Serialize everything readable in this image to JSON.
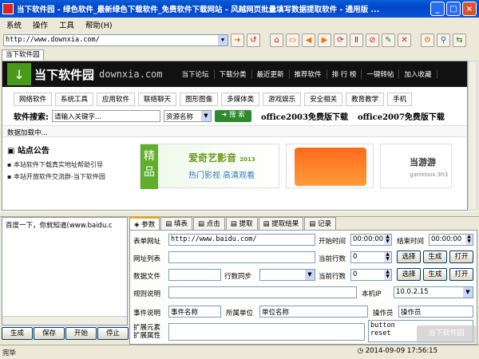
{
  "window": {
    "title": "当下软件园 - 绿色软件_最新绿色下载软件_免费软件下载网站 - 风越网页批量填写数据提取软件 - 通用版 ..."
  },
  "menu": [
    "系统",
    "操作",
    "工具",
    "帮助(H)"
  ],
  "toolbar": {
    "address": "http://www.downxia.com/"
  },
  "browser_tab": "当下软件园",
  "site": {
    "logo_icon": "↓",
    "logo_text": "当下软件园",
    "domain": "downxia.com",
    "topnav": [
      "当下论坛",
      "下载分类",
      "最近更新",
      "推荐软件",
      "排 行 榜",
      "一键转帖",
      "加入收藏"
    ],
    "categories": [
      "网络软件",
      "系统工具",
      "应用软件",
      "联络聊天",
      "图形图像",
      "多媒体类",
      "游戏娱乐",
      "安全相关",
      "教育教学",
      "手机"
    ],
    "search_label": "软件搜索:",
    "search_placeholder": "请输入关键字...",
    "search_scope": "资源名称",
    "search_button": "搜 索",
    "promo1": "office2003免费版下载",
    "promo2": "office2007免费版下载",
    "loading": "数据加载中...",
    "notice_title": "站点公告",
    "notices": [
      "本站软件下载真实地址帮助引导",
      "本站开放软件交流群-当下软件园"
    ],
    "banner_tag": "精",
    "banner_sub_tag": "品",
    "banner_title": "爱奇艺影音",
    "banner_year": "2013",
    "banner_sub": "热门影视 高清观看",
    "game_title": "当游游",
    "game_sub": "gamebox.3h3"
  },
  "left_panel": {
    "item": "百度一下，你就知道(www.baidu.c",
    "buttons": [
      "生成",
      "保存",
      "开始",
      "停止"
    ]
  },
  "tabs": [
    "参数",
    "填表",
    "点击",
    "提取",
    "提取结果",
    "记录"
  ],
  "form": {
    "form_url_label": "表单网址",
    "form_url": "http://www.baidu.com/",
    "start_time_label": "开始时间",
    "start_time": "00:00:00",
    "end_time_label": "结束时间",
    "end_time": "00:00:00",
    "url_list_label": "网址列表",
    "current_row_label": "当前行数",
    "current_row": "0",
    "data_file_label": "数据文件",
    "row_sync_label": "行数同步",
    "current_row2_label": "当前行数",
    "current_row2": "0",
    "rule_label": "规则说明",
    "local_ip_label": "本机IP",
    "local_ip": "10.0.2.15",
    "event_label": "事件说明",
    "event_value": "事件名称",
    "unit_label": "所属单位",
    "unit_value": "单位名称",
    "operator_label": "操作员",
    "operator_value": "操作员",
    "ext_elem_label": "扩展元素",
    "ext_attr_label": "扩展属性",
    "ext_list": [
      "button",
      "reset"
    ],
    "btn_select": "选择",
    "btn_generate": "生成",
    "btn_open": "打开"
  },
  "status": {
    "text": "完毕",
    "clock": "2014-09-09  17:56:15",
    "watermark": "当下软件园"
  }
}
